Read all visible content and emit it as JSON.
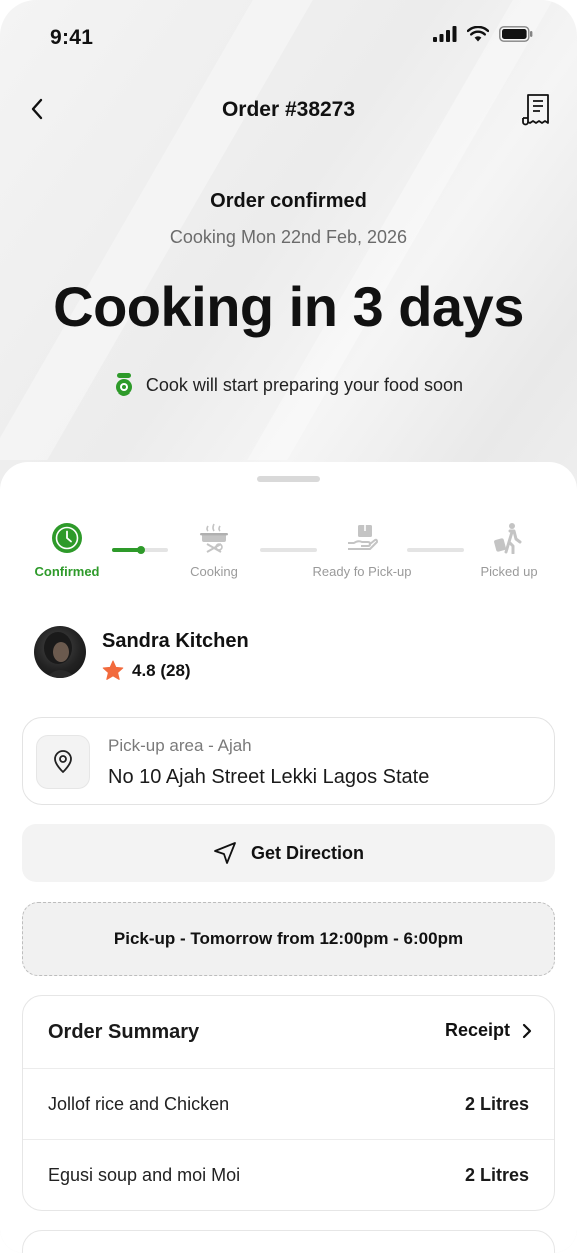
{
  "status_bar": {
    "time": "9:41"
  },
  "nav": {
    "title": "Order #38273"
  },
  "hero": {
    "status": "Order confirmed",
    "date": "Cooking Mon 22nd Feb, 2026",
    "countdown": "Cooking in 3 days",
    "note": "Cook will start preparing your food soon"
  },
  "stepper": {
    "steps": [
      {
        "label": "Confirmed",
        "icon": "clock-icon",
        "active": true
      },
      {
        "label": "Cooking",
        "icon": "cooking-pot-icon",
        "active": false
      },
      {
        "label": "Ready fo Pick-up",
        "icon": "hand-package-icon",
        "active": false
      },
      {
        "label": "Picked up",
        "icon": "walking-person-luggage-icon",
        "active": false
      }
    ]
  },
  "cook": {
    "name": "Sandra Kitchen",
    "rating": "4.8 (28)"
  },
  "pickup": {
    "area": "Pick-up area - Ajah",
    "address": "No 10 Ajah Street Lekki Lagos State"
  },
  "direction": {
    "label": "Get Direction"
  },
  "pickup_time": {
    "label": "Pick-up - Tomorrow from 12:00pm - 6:00pm"
  },
  "summary": {
    "title": "Order Summary",
    "receipt_label": "Receipt",
    "items": [
      {
        "name": "Jollof rice and Chicken",
        "qty": "2 Litres"
      },
      {
        "name": "Egusi soup and moi Moi",
        "qty": "2 Litres"
      }
    ]
  },
  "colors": {
    "accent_green": "#2e9a2a",
    "star_orange": "#f26a3d"
  }
}
